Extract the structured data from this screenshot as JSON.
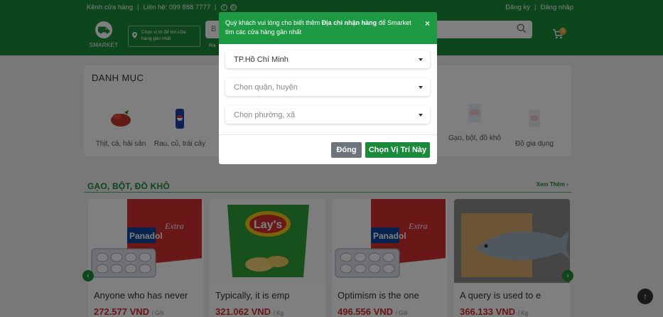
{
  "topbar": {
    "store_channel": "Kênh cửa hàng",
    "contact": "Liên hệ: 099 888 7777",
    "register": "Đăng ký",
    "login": "Đăng nhập"
  },
  "brand": {
    "logo_text": "SMARKET",
    "location_prompt": "Chọn vị trí để tìm cửa hàng gần nhất"
  },
  "search": {
    "placeholder": "B",
    "below_text": "Ra"
  },
  "cart": {
    "badge_count": "0"
  },
  "categories": {
    "title": "DANH MỤC",
    "items": [
      {
        "label": "Thịt, cá, hải sản",
        "icon": "meat-icon"
      },
      {
        "label": "Rau, củ, trái cây",
        "icon": "drink-can-icon"
      },
      {
        "label": "Gạo, bột, đồ khô",
        "icon": "flour-bag-icon"
      },
      {
        "label": "Đồ gia dụng",
        "icon": "household-icon"
      }
    ]
  },
  "section": {
    "title": "GẠO, BỘT, ĐỒ KHÔ",
    "see_more": "Xem Thêm"
  },
  "products": [
    {
      "name": "Anyone who has never",
      "price": "272.577 VND",
      "unit": "/ Gói",
      "image": "panadol-box"
    },
    {
      "name": "Typically, it is emp",
      "price": "321.062 VND",
      "unit": "/ Kg",
      "image": "lays-bag"
    },
    {
      "name": "Optimism is the one",
      "price": "496.556 VND",
      "unit": "/ Gói",
      "image": "panadol-box"
    },
    {
      "name": "A query is used to e",
      "price": "366.133 VND",
      "unit": "/ Kg",
      "image": "fish"
    }
  ],
  "modal": {
    "message_prefix": "Quý khách vui lòng cho biết thêm ",
    "message_bold": "Địa chỉ nhận hàng",
    "message_suffix": " để Smarket tìm các cửa hàng gần nhất",
    "city": "TP.Hồ Chí Minh",
    "district_placeholder": "Chọn quận, huyện",
    "ward_placeholder": "Chọn phường, xã",
    "close_label": "Đóng",
    "confirm_label": "Chọn Vị Trí Này",
    "close_icon": "×"
  },
  "colors": {
    "brand_green": "#1b8a3a",
    "modal_header_green": "#1e9a45",
    "price_red": "#d32f2f"
  }
}
